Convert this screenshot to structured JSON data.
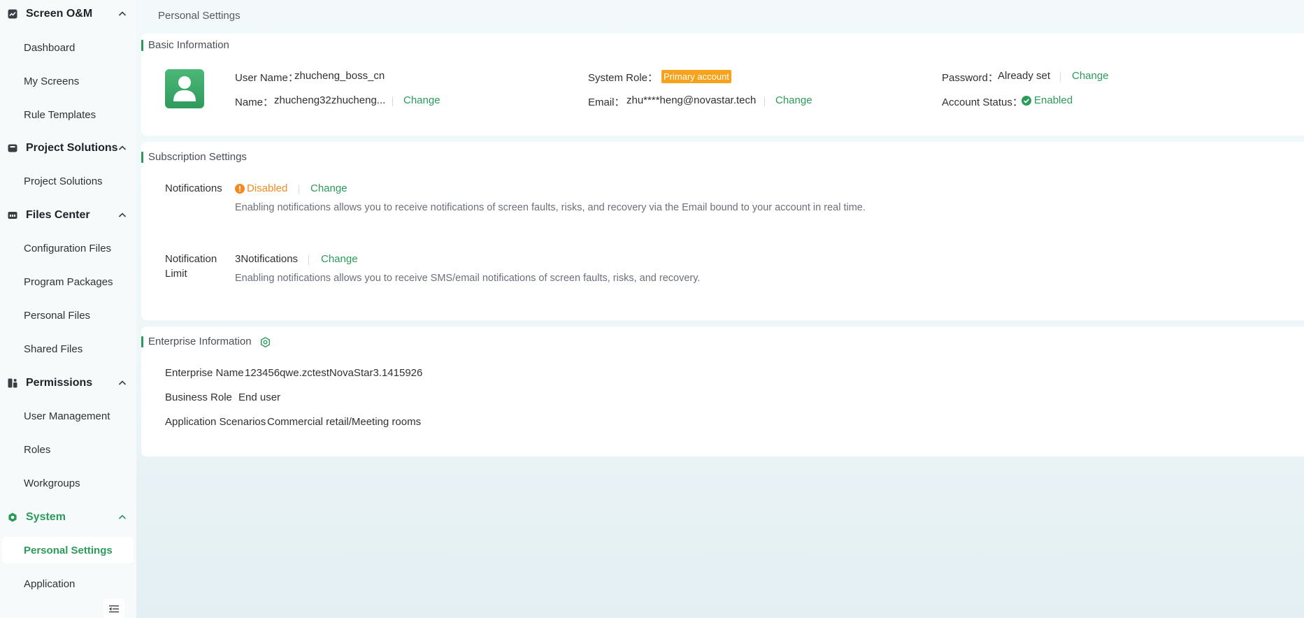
{
  "sidebar": {
    "groups": [
      {
        "label": "Screen O&M",
        "icon": "chart-line-icon",
        "items": [
          "Dashboard",
          "My Screens",
          "Rule Templates"
        ]
      },
      {
        "label": "Project Solutions",
        "icon": "briefcase-icon",
        "items": [
          "Project Solutions"
        ]
      },
      {
        "label": "Files Center",
        "icon": "folder-icon",
        "items": [
          "Configuration Files",
          "Program Packages",
          "Personal Files",
          "Shared Files"
        ]
      },
      {
        "label": "Permissions",
        "icon": "permissions-icon",
        "items": [
          "User Management",
          "Roles",
          "Workgroups"
        ]
      },
      {
        "label": "System",
        "icon": "system-gear-icon",
        "items": [
          "Personal Settings",
          "Application"
        ]
      }
    ],
    "active_item": "Personal Settings",
    "collapse_icon": "collapse-menu-icon"
  },
  "breadcrumb": "Personal Settings",
  "basic": {
    "title": "Basic Information",
    "user_name_label": "User Name：",
    "user_name_value": "zhucheng_boss_cn",
    "name_label": "Name：",
    "name_value": "zhucheng32zhucheng...",
    "name_change": "Change",
    "system_role_label": "System Role：",
    "system_role_badge": "Primary account",
    "email_label": "Email：",
    "email_value": "zhu****heng@novastar.tech",
    "email_change": "Change",
    "password_label": "Password：",
    "password_value": "Already set",
    "password_change": "Change",
    "account_status_label": "Account Status：",
    "account_status_value": "Enabled"
  },
  "subscription": {
    "title": "Subscription Settings",
    "notifications_label": "Notifications",
    "notifications_status": "Disabled",
    "notifications_change": "Change",
    "notifications_desc": "Enabling notifications allows you to receive notifications of screen faults, risks, and recovery via the Email bound to your account in real time.",
    "limit_label_line1": "Notification",
    "limit_label_line2": "Limit",
    "limit_value": "3Notifications",
    "limit_change": "Change",
    "limit_desc": "Enabling notifications allows you to receive SMS/email notifications of screen faults, risks, and recovery."
  },
  "enterprise": {
    "title": "Enterprise Information",
    "enterprise_name_label": "Enterprise Name",
    "enterprise_name_value": "123456qwe.zctestNovaStar3.1415926",
    "business_role_label": "Business Role",
    "business_role_value": "End user",
    "scenarios_label": "Application Scenarios",
    "scenarios_value": "Commercial retail/Meeting rooms"
  },
  "colors": {
    "accent": "#2b9a5b",
    "warning": "#f08c23",
    "badge": "#f7a21b"
  }
}
